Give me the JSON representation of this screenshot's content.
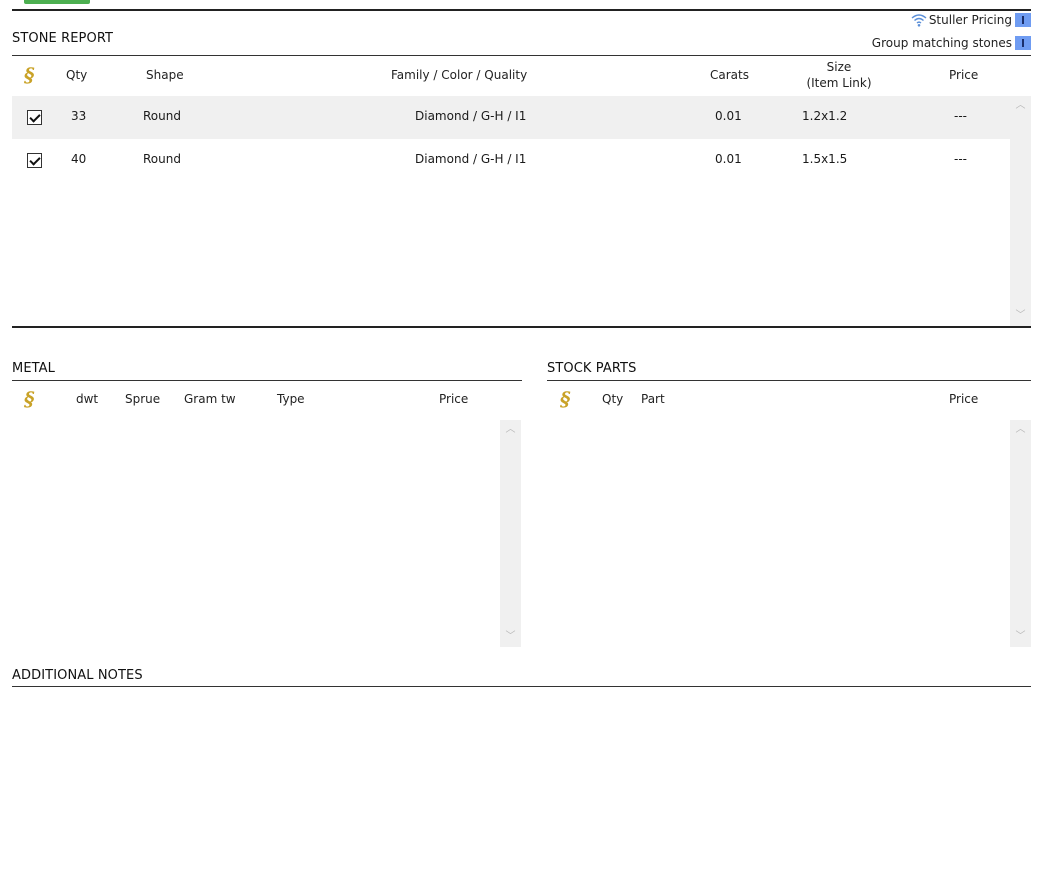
{
  "stone_report": {
    "title": "STONE REPORT",
    "stuller_pricing_label": "Stuller Pricing",
    "group_matching_label": "Group matching stones",
    "columns": {
      "qty": "Qty",
      "shape": "Shape",
      "family": "Family / Color / Quality",
      "carats": "Carats",
      "size": "Size",
      "size_sub": "(Item Link)",
      "price": "Price"
    },
    "rows": [
      {
        "checked": true,
        "qty": "33",
        "shape": "Round",
        "family": "Diamond / G-H / I1",
        "carats": "0.01",
        "size": "1.2x1.2",
        "price": "---"
      },
      {
        "checked": true,
        "qty": "40",
        "shape": "Round",
        "family": "Diamond / G-H / I1",
        "carats": "0.01",
        "size": "1.5x1.5",
        "price": "---"
      }
    ]
  },
  "metal": {
    "title": "METAL",
    "columns": {
      "dwt": "dwt",
      "sprue": "Sprue",
      "gram_tw": "Gram tw",
      "type": "Type",
      "price": "Price"
    }
  },
  "stock_parts": {
    "title": "STOCK PARTS",
    "columns": {
      "qty": "Qty",
      "part": "Part",
      "price": "Price"
    }
  },
  "additional_notes": {
    "title": "ADDITIONAL NOTES"
  },
  "icons": {
    "stuller_logo": "stuller-s-icon",
    "wifi": "wifi-icon",
    "toggle": "toggle-icon"
  },
  "colors": {
    "accent_green": "#4caf50",
    "stuller_gold": "#c9a227",
    "toggle_blue": "#6f9cf2"
  }
}
